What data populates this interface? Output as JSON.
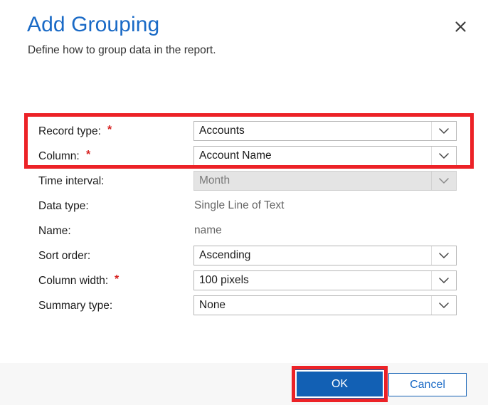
{
  "dialog": {
    "title": "Add Grouping",
    "subtitle": "Define how to group data in the report.",
    "close_icon": "close-icon"
  },
  "colors": {
    "title_blue": "#1a6ac6",
    "primary_button": "#1260b4",
    "annotation_red": "#ec2227",
    "required_star": "#d6201f",
    "footer_bg": "#f7f7f7",
    "disabled_bg": "#e4e4e4"
  },
  "form": {
    "required_marker": "*",
    "rows": [
      {
        "label": "Record type:",
        "required": true,
        "control": "dropdown",
        "value": "Accounts",
        "disabled": false
      },
      {
        "label": "Column:",
        "required": true,
        "control": "dropdown",
        "value": "Account Name",
        "disabled": false
      },
      {
        "label": "Time interval:",
        "required": false,
        "control": "dropdown",
        "value": "Month",
        "disabled": true
      },
      {
        "label": "Data type:",
        "required": false,
        "control": "static",
        "value": "Single Line of Text",
        "disabled": false
      },
      {
        "label": "Name:",
        "required": false,
        "control": "static",
        "value": "name",
        "disabled": false
      },
      {
        "label": "Sort order:",
        "required": false,
        "control": "dropdown",
        "value": "Ascending",
        "disabled": false
      },
      {
        "label": "Column width:",
        "required": true,
        "control": "dropdown",
        "value": "100 pixels",
        "disabled": false
      },
      {
        "label": "Summary type:",
        "required": false,
        "control": "dropdown",
        "value": "None",
        "disabled": false
      }
    ]
  },
  "footer": {
    "ok_label": "OK",
    "cancel_label": "Cancel"
  },
  "annotations": [
    {
      "name": "highlight-record-type-and-column"
    },
    {
      "name": "highlight-ok-button"
    }
  ]
}
